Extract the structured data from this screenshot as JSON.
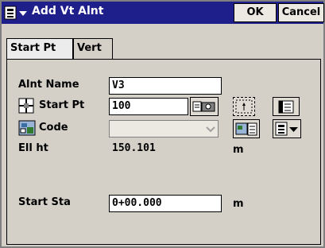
{
  "window": {
    "title": "Add Vt Alnt",
    "ok_label": "OK",
    "cancel_label": "Cancel"
  },
  "tabs": [
    {
      "label": "Start Pt"
    },
    {
      "label": "Vert"
    }
  ],
  "form": {
    "alnt_name_label": "Alnt Name",
    "alnt_name_value": "V3",
    "start_pt_label": "Start Pt",
    "start_pt_value": "100",
    "code_label": "Code",
    "code_value": "",
    "ell_ht_label": "Ell ht",
    "ell_ht_value": "150.101",
    "ell_ht_unit": "m",
    "start_sta_label": "Start Sta",
    "start_sta_value": "0+00.000",
    "start_sta_unit": "m"
  },
  "colors": {
    "titlebar": "#1f1f8c",
    "window_bg": "#d4d0c8",
    "field_bg": "#ffffff"
  },
  "icons": [
    "menu-icon",
    "crosshair-icon",
    "code-icon",
    "camera-icon",
    "map-select-icon",
    "list-icon",
    "code-list-icon",
    "dropdown-icon"
  ]
}
